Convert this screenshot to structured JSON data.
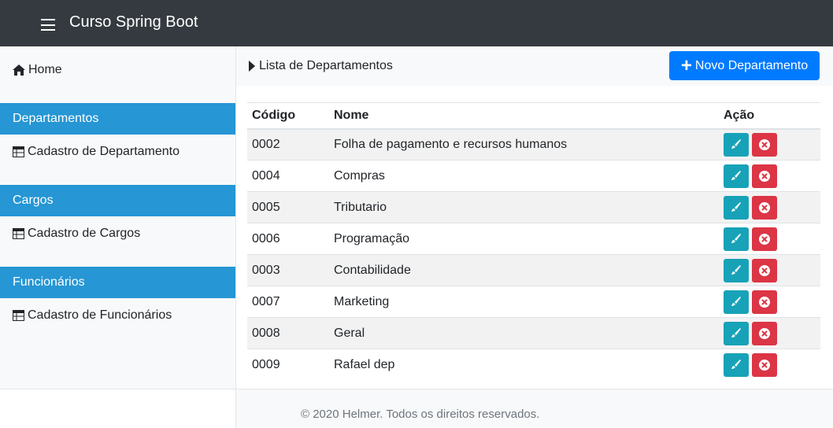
{
  "navbar": {
    "brand": "Curso Spring Boot",
    "toggle_icon": "hamburger-icon",
    "bg": "#343a40"
  },
  "sidebar": {
    "home": "Home",
    "sections": [
      {
        "title": "Departamentos",
        "link": "Cadastro de Departamento"
      },
      {
        "title": "Cargos",
        "link": "Cadastro de Cargos"
      },
      {
        "title": "Funcionários",
        "link": "Cadastro de Funcionários"
      }
    ],
    "section_color": "#2696d4"
  },
  "breadcrumb": {
    "label": "Lista de Departamentos"
  },
  "actions": {
    "new_button": "Novo Departamento",
    "new_color": "#007bff"
  },
  "table": {
    "headers": {
      "code": "Código",
      "name": "Nome",
      "action": "Ação"
    },
    "rows": [
      {
        "code": "0002",
        "name": "Folha de pagamento e recursos humanos"
      },
      {
        "code": "0004",
        "name": "Compras"
      },
      {
        "code": "0005",
        "name": "Tributario"
      },
      {
        "code": "0006",
        "name": "Programação"
      },
      {
        "code": "0003",
        "name": "Contabilidade"
      },
      {
        "code": "0007",
        "name": "Marketing"
      },
      {
        "code": "0008",
        "name": "Geral"
      },
      {
        "code": "0009",
        "name": "Rafael dep"
      }
    ],
    "edit_color": "#17a2b8",
    "delete_color": "#dc3545"
  },
  "footer": {
    "text": "© 2020 Helmer. Todos os direitos reservados."
  }
}
